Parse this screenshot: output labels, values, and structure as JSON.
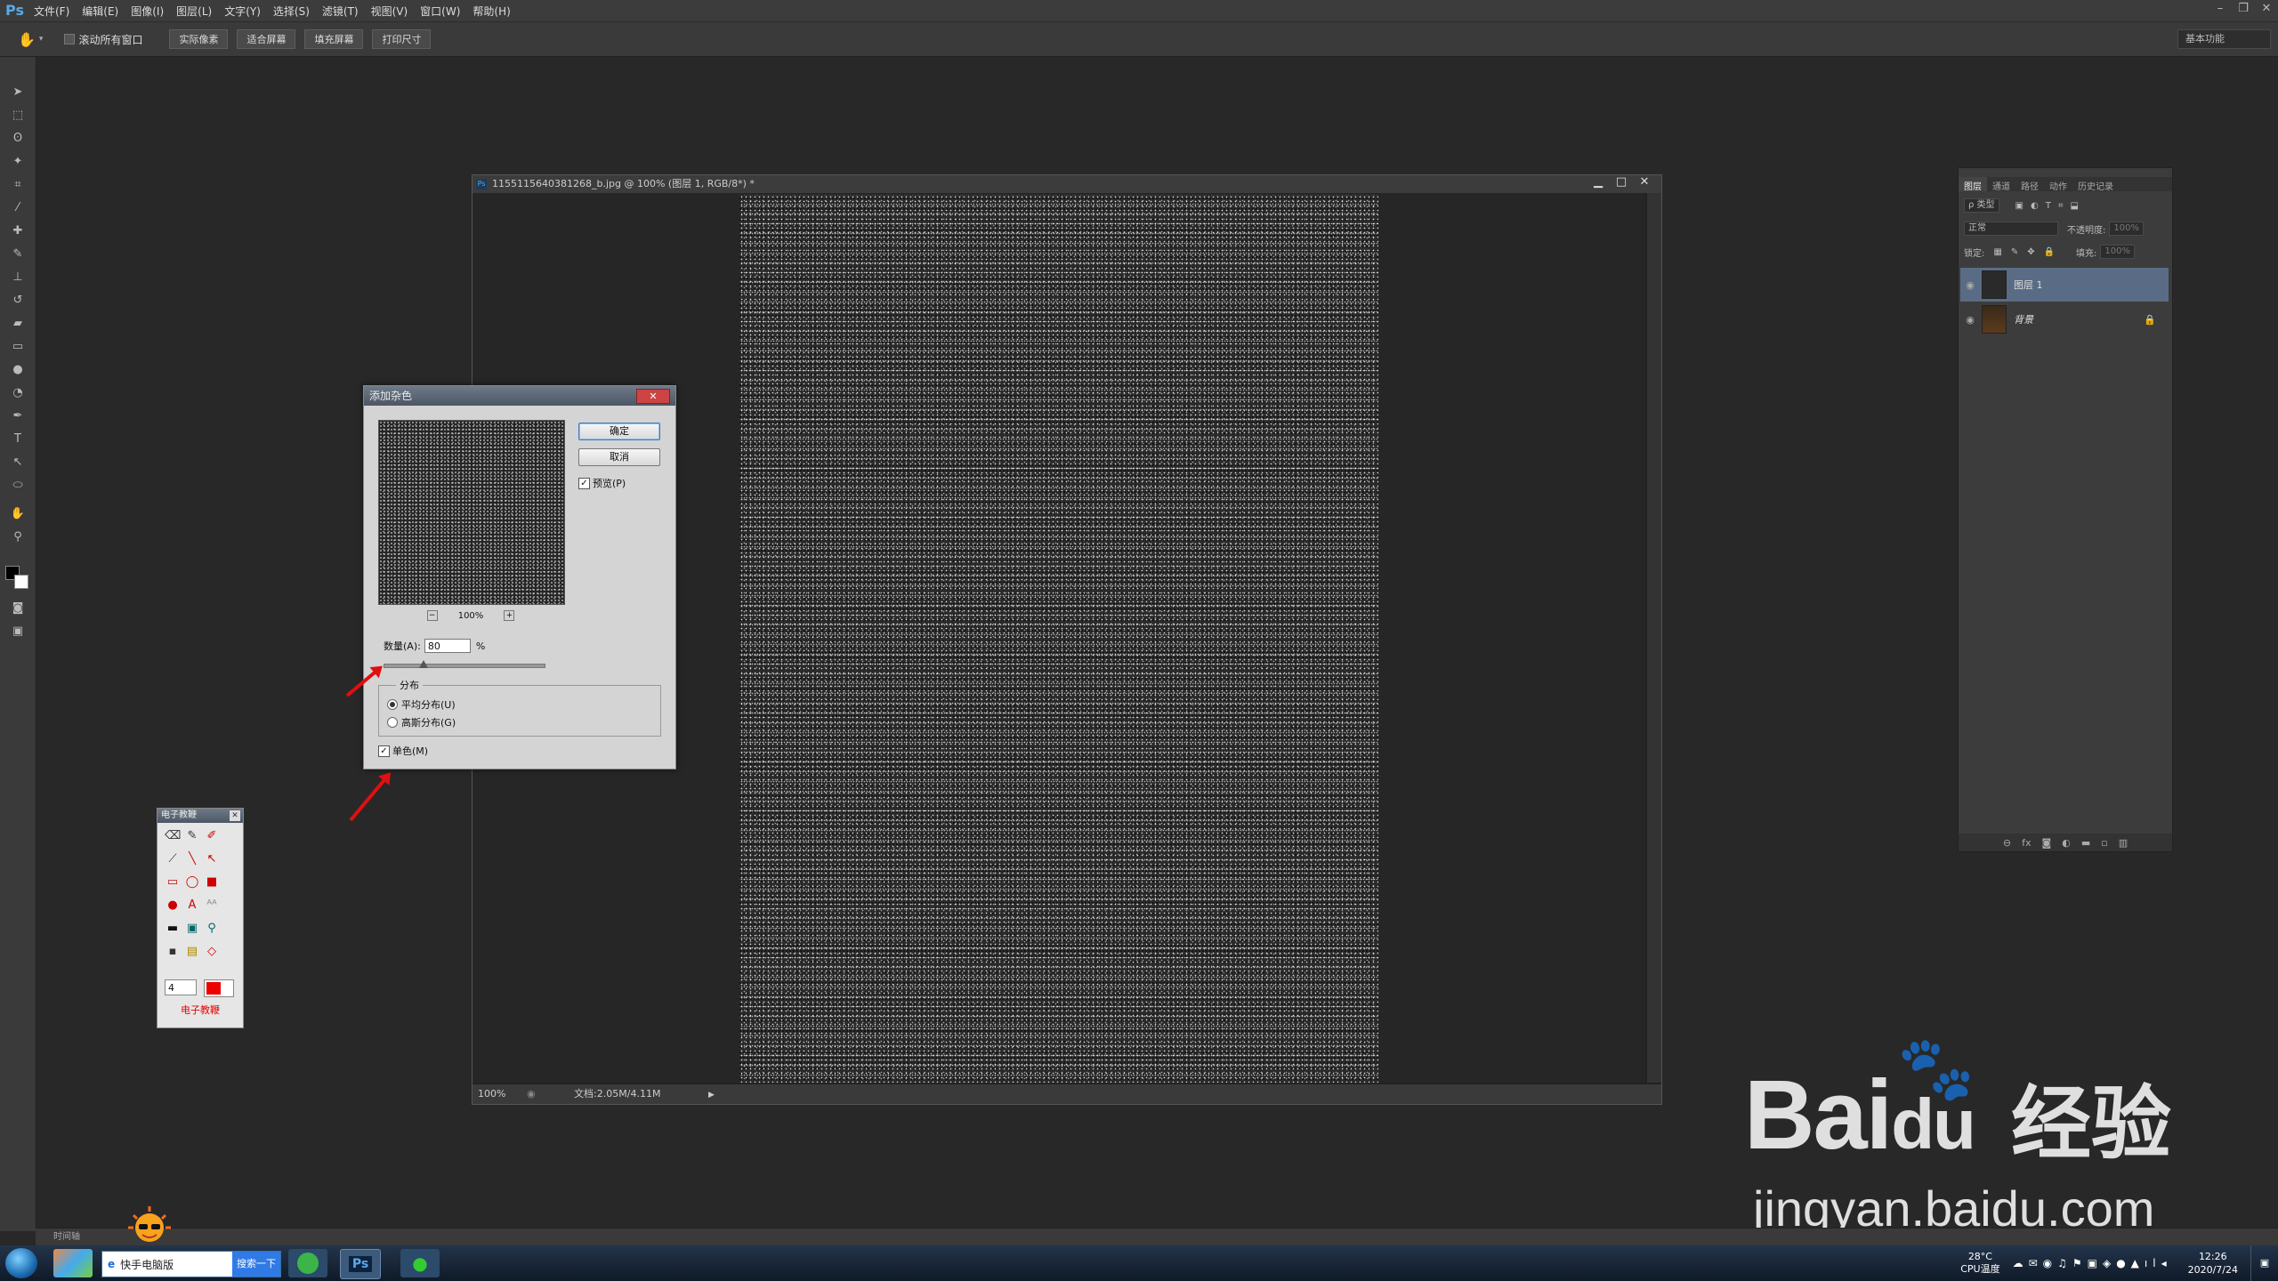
{
  "menubar": {
    "logo": "Ps",
    "items": [
      "文件(F)",
      "编辑(E)",
      "图像(I)",
      "图层(L)",
      "文字(Y)",
      "选择(S)",
      "滤镜(T)",
      "视图(V)",
      "窗口(W)",
      "帮助(H)"
    ]
  },
  "options_bar": {
    "scroll_all": "滚动所有窗口",
    "buttons": [
      "实际像素",
      "适合屏幕",
      "填充屏幕",
      "打印尺寸"
    ],
    "workspace": "基本功能"
  },
  "document": {
    "title": "1155115640381268_b.jpg @ 100% (图层 1, RGB/8*) *",
    "zoom": "100%",
    "doc_info": "文档:2.05M/4.11M"
  },
  "dialog": {
    "title": "添加杂色",
    "ok": "确定",
    "cancel": "取消",
    "preview_label": "预览(P)",
    "preview_checked": true,
    "zoom": "100%",
    "zoom_minus": "−",
    "zoom_plus": "+",
    "amount_label": "数量(A):",
    "amount_value": "80",
    "amount_unit": "%",
    "distribution_label": "分布",
    "uniform": "平均分布(U)",
    "gaussian": "高斯分布(G)",
    "uniform_selected": true,
    "monochromatic": "单色(M)",
    "monochromatic_checked": true
  },
  "mini_panel": {
    "title": "电子教鞭",
    "size_value": "4",
    "footer": "电子教鞭",
    "color": "#e00000"
  },
  "layers_panel": {
    "tabs": [
      "图层",
      "通道",
      "路径",
      "动作",
      "历史记录"
    ],
    "filter": "ρ 类型",
    "blend_mode": "正常",
    "opacity_label": "不透明度:",
    "opacity_value": "100%",
    "lock_label": "锁定:",
    "fill_label": "填充:",
    "fill_value": "100%",
    "layers": [
      {
        "name": "图层 1"
      },
      {
        "name": "背景"
      }
    ],
    "footer_icons": [
      "link-icon",
      "fx-icon",
      "mask-icon",
      "adjustment-icon",
      "group-icon",
      "new-layer-icon",
      "trash-icon"
    ]
  },
  "timeline": {
    "label": "时间轴"
  },
  "watermark": {
    "brand": "Bai",
    "suffix": "du",
    "product": "经验",
    "url": "jingyan.baidu.com"
  },
  "taskbar": {
    "search_text": "快手电脑版",
    "search_button": "搜索一下",
    "temperature": "28°C",
    "temperature_label": "CPU温度",
    "time": "12:26",
    "date": "2020/7/24"
  }
}
